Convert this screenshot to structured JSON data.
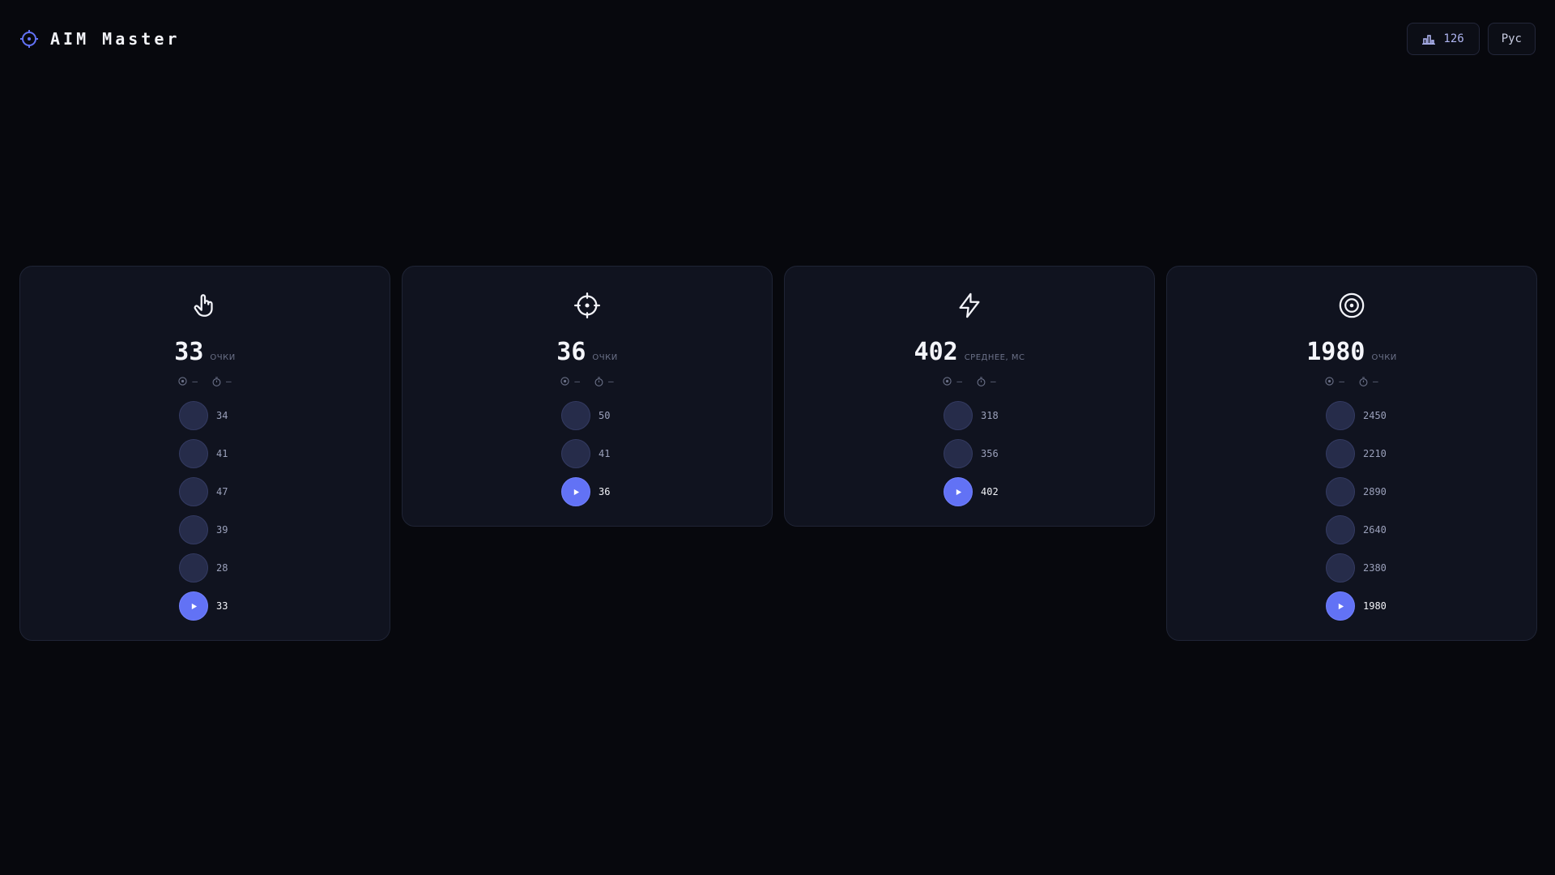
{
  "app": {
    "title": "AIM Master"
  },
  "header": {
    "stats_count": "126",
    "language": "Рус"
  },
  "colors": {
    "accent": "#6272f5",
    "background": "#07080d",
    "card": "#10131f"
  },
  "cards": [
    {
      "icon": "pointer-hand-icon",
      "score": "33",
      "unit": "очки",
      "meta": {
        "target": "—",
        "time": "—"
      },
      "history": [
        "34",
        "41",
        "47",
        "39",
        "28",
        "33"
      ]
    },
    {
      "icon": "crosshair-icon",
      "score": "36",
      "unit": "очки",
      "meta": {
        "target": "—",
        "time": "—"
      },
      "history": [
        "50",
        "41",
        "36"
      ]
    },
    {
      "icon": "lightning-icon",
      "score": "402",
      "unit": "среднее, мс",
      "meta": {
        "target": "—",
        "time": "—"
      },
      "history": [
        "318",
        "356",
        "402"
      ]
    },
    {
      "icon": "target-rings-icon",
      "score": "1980",
      "unit": "очки",
      "meta": {
        "target": "—",
        "time": "—"
      },
      "history": [
        "2450",
        "2210",
        "2890",
        "2640",
        "2380",
        "1980"
      ]
    }
  ]
}
